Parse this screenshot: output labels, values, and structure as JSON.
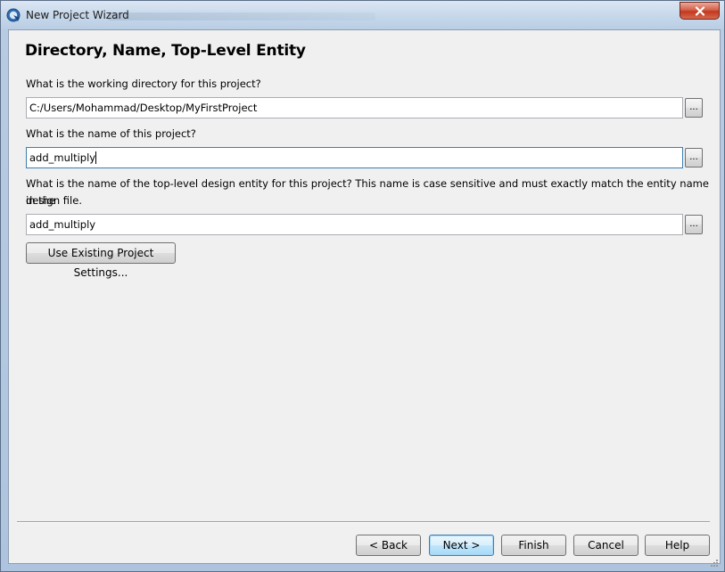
{
  "window": {
    "title": "New Project Wizard"
  },
  "page": {
    "heading": "Directory, Name, Top-Level Entity"
  },
  "fields": {
    "directory": {
      "label": "What is the working directory for this project?",
      "value": "C:/Users/Mohammad/Desktop/MyFirstProject",
      "browse_label": "..."
    },
    "project_name": {
      "label": "What is the name of this project?",
      "value": "add_multiply",
      "browse_label": "..."
    },
    "top_level_entity": {
      "label_line1": "What is the name of the top-level design entity for this project? This name is case sensitive and must exactly match the entity name in the",
      "label_line2": "design file.",
      "value": "add_multiply",
      "browse_label": "..."
    }
  },
  "buttons": {
    "use_existing": "Use Existing Project Settings...",
    "back": "< Back",
    "next": "Next >",
    "finish": "Finish",
    "cancel": "Cancel",
    "help": "Help"
  },
  "colors": {
    "close_button": "#c0391f",
    "default_button_border": "#3c7fb1",
    "focus_border": "#3c7fb1"
  }
}
